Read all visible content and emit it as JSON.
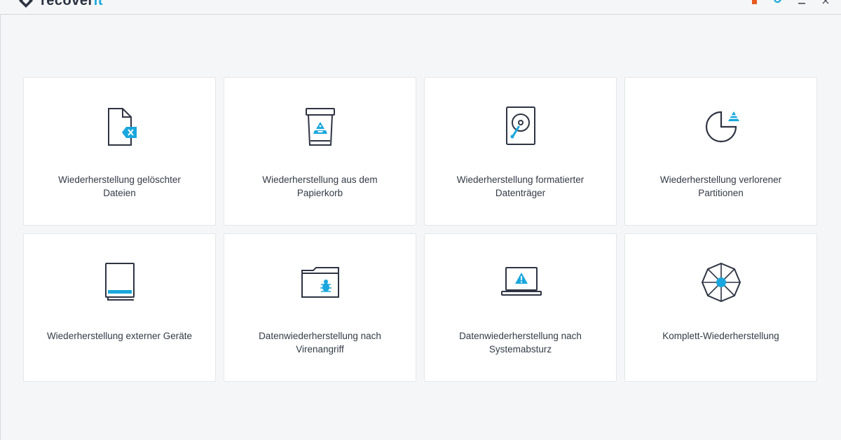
{
  "app": {
    "logo_text": "recover",
    "logo_accent": "it"
  },
  "colors": {
    "accent": "#19a7de",
    "icon_stroke": "#2e3443",
    "background": "#f5f6f7",
    "card": "#ffffff"
  },
  "topbar": {
    "icons": [
      "cart-icon",
      "twitter-icon",
      "minimize-icon",
      "close-icon"
    ]
  },
  "cards": [
    {
      "icon": "deleted-file-icon",
      "line1": "Wiederherstellung gelöschter",
      "line2": "Dateien"
    },
    {
      "icon": "recycle-bin-icon",
      "line1": "Wiederherstellung aus dem",
      "line2": "Papierkorb"
    },
    {
      "icon": "hard-drive-icon",
      "line1": "Wiederherstellung formatierter",
      "line2": "Datenträger"
    },
    {
      "icon": "partition-icon",
      "line1": "Wiederherstellung verlorener",
      "line2": "Partitionen"
    },
    {
      "icon": "external-device-icon",
      "line1": "Wiederherstellung externer Geräte",
      "line2": ""
    },
    {
      "icon": "virus-folder-icon",
      "line1": "Datenwiederherstellung nach",
      "line2": "Virenangriff"
    },
    {
      "icon": "crashed-laptop-icon",
      "line1": "Datenwiederherstellung nach",
      "line2": "Systemabsturz"
    },
    {
      "icon": "full-recovery-icon",
      "line1": "Komplett-Wiederherstellung",
      "line2": ""
    }
  ]
}
